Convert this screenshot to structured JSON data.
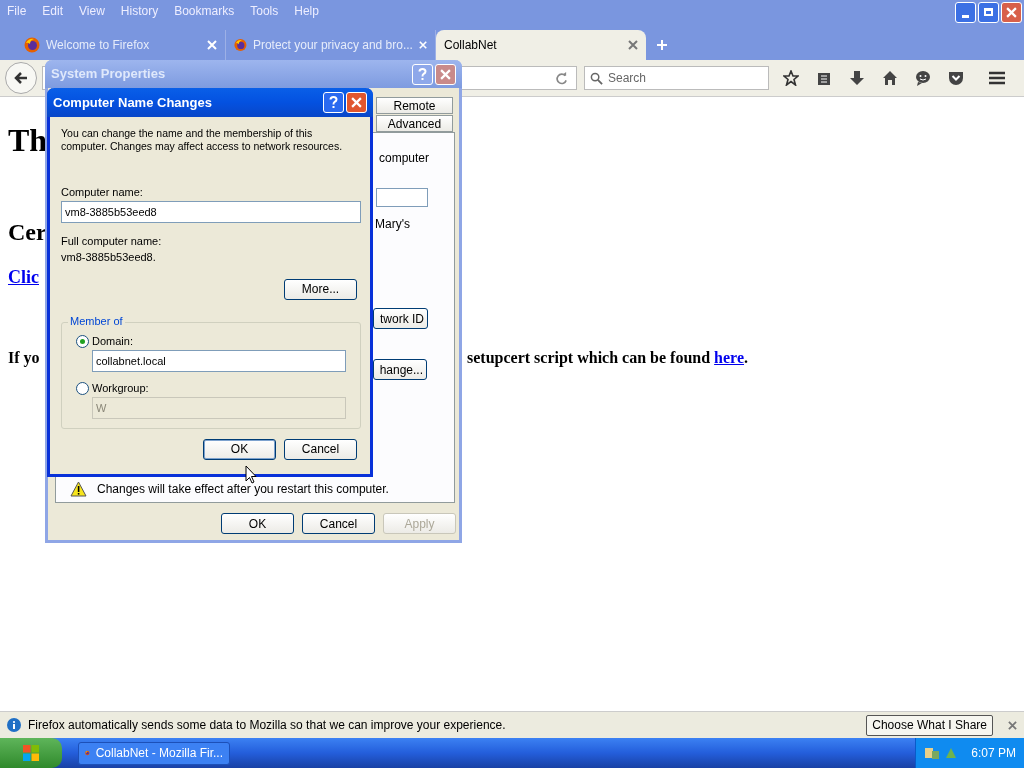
{
  "menu": [
    "File",
    "Edit",
    "View",
    "History",
    "Bookmarks",
    "Tools",
    "Help"
  ],
  "tabs": [
    {
      "title": "Welcome to Firefox",
      "selected": false
    },
    {
      "title": "Protect your privacy and bro...",
      "selected": false
    },
    {
      "title": "CollabNet",
      "selected": true
    }
  ],
  "search": {
    "placeholder": "Search"
  },
  "page": {
    "heading": "Th",
    "subheading": "Cer",
    "link": "Clic",
    "para_start": "If yo",
    "para_end": "setupcert script which can be found",
    "para_link": "here",
    "para_tail": "."
  },
  "system_properties": {
    "title": "System Properties",
    "tabs": [
      {
        "label": "Remote",
        "selected": false
      },
      {
        "label": "Advanced",
        "selected": false
      }
    ],
    "text_1": "computer",
    "text_2": "Mary's",
    "network_button": "twork ID",
    "change_button": "hange...",
    "notice": "Changes will take effect after you restart this computer.",
    "buttons": [
      {
        "label": "OK",
        "disabled": false
      },
      {
        "label": "Cancel",
        "disabled": false
      },
      {
        "label": "Apply",
        "disabled": true
      }
    ]
  },
  "name_dialog": {
    "title": "Computer Name Changes",
    "intro": "You can change the name and the membership of this computer. Changes may affect access to network resources.",
    "computer_name_label": "Computer name:",
    "computer_name": "vm8-3885b53eed8",
    "full_name_label": "Full computer name:",
    "full_name": "vm8-3885b53eed8.",
    "more_button": "More...",
    "member_of": "Member of",
    "options": [
      {
        "label": "Domain:",
        "selected": true,
        "value": "collabnet.local",
        "disabled": false
      },
      {
        "label": "Workgroup:",
        "selected": false,
        "value": "W",
        "disabled": true
      }
    ],
    "buttons": [
      {
        "label": "OK",
        "default": true
      },
      {
        "label": "Cancel",
        "default": false
      }
    ]
  },
  "notification": {
    "text": "Firefox automatically sends some data to Mozilla so that we can improve your experience.",
    "button": "Choose What I Share"
  },
  "taskbar": {
    "task": "CollabNet - Mozilla Fir...",
    "clock": "6:07 PM"
  }
}
